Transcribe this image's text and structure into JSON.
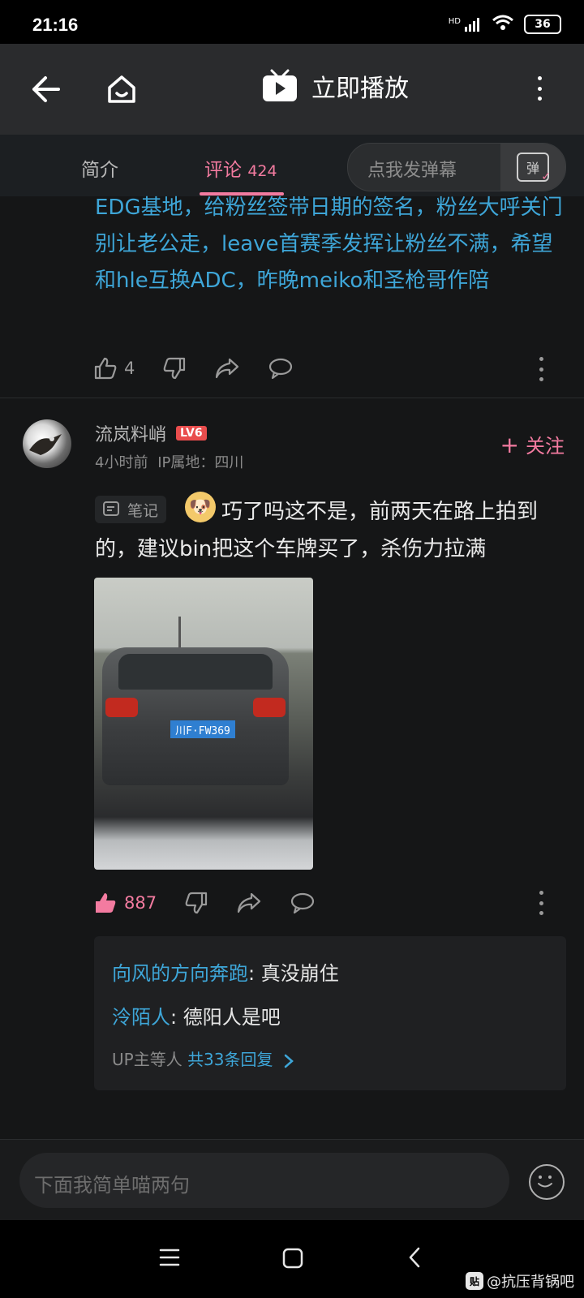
{
  "status_bar": {
    "time": "21:16",
    "network": "HD",
    "battery": "36"
  },
  "header": {
    "title": "立即播放"
  },
  "tabs": {
    "intro": "简介",
    "comments_label": "评论",
    "comments_count": "424",
    "danmaku_placeholder": "点我发弹幕",
    "danmaku_btn": "弹"
  },
  "prev_comment": {
    "text": "EDG基地，给粉丝签带日期的签名，粉丝大呼关门别让老公走，leave首赛季发挥让粉丝不满，希望和hle互换ADC，昨晚meiko和圣枪哥作陪",
    "likes": "4"
  },
  "comment": {
    "username": "流岚料峭",
    "level": "LV6",
    "time": "4小时前",
    "ip": "IP属地：四川",
    "follow_label": "关注",
    "note_badge": "笔记",
    "text": "巧了吗这不是，前两天在路上拍到的，建议bin把这个车牌买了，杀伤力拉满",
    "photo_plate": "川F·FW369",
    "likes": "887",
    "replies": [
      {
        "name": "向风的方向奔跑",
        "text": ": 真没崩住"
      },
      {
        "name": "泠陌人",
        "text": ": 德阳人是吧"
      }
    ],
    "replies_more_prefix": "UP主等人",
    "replies_more_count": "共33条回复"
  },
  "input": {
    "placeholder": "下面我简单喵两句"
  },
  "watermark": {
    "logo": "贴",
    "text": "@抗压背锅吧"
  },
  "colors": {
    "accent": "#f37ba0",
    "link": "#3ea6d8",
    "background": "#151617"
  }
}
